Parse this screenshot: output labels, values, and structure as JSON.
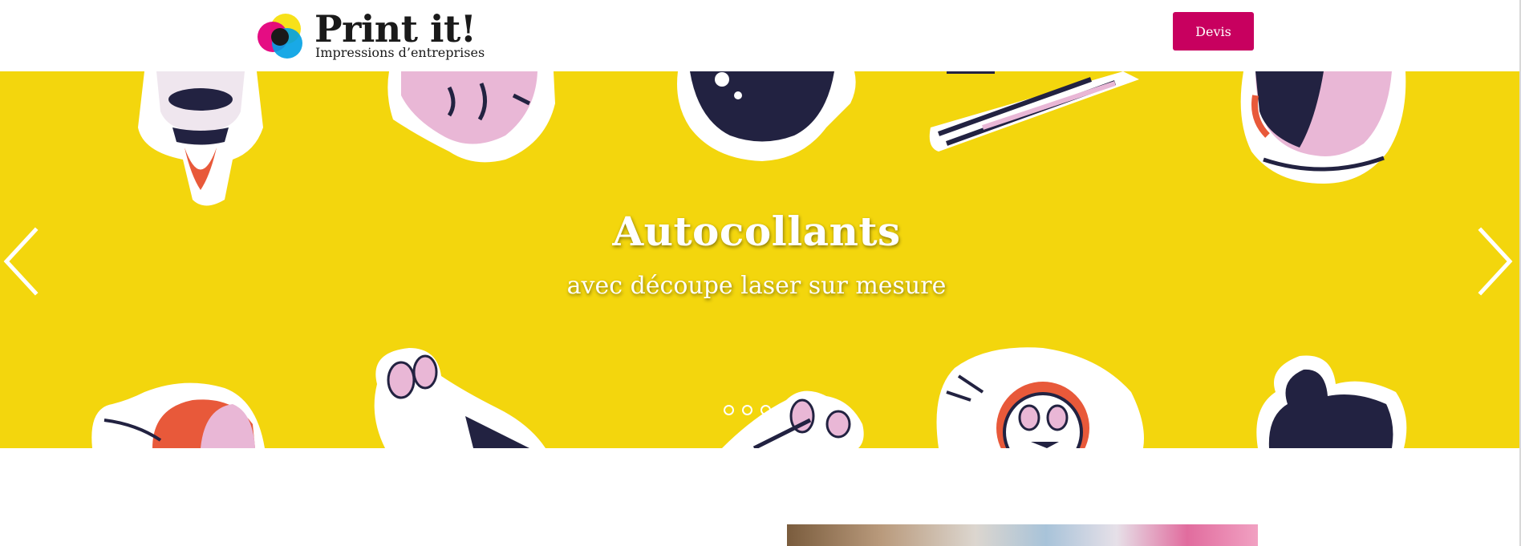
{
  "header": {
    "logo": {
      "title": "Print it!",
      "tagline": "Impressions d’entreprises",
      "icon": "cmyk-circles-logo-icon",
      "colors": [
        "#f7e11a",
        "#e4007c",
        "#00a0e3",
        "#1a1a1a"
      ]
    },
    "quote_button_label": "Devis"
  },
  "slider": {
    "title": "Autocollants",
    "subtitle": "avec découpe laser sur mesure",
    "background_color": "#f3d60d",
    "prev_icon": "chevron-left-icon",
    "next_icon": "chevron-right-icon",
    "active_dot": 4,
    "dot_count": 4
  },
  "colors": {
    "accent": "#c8005f",
    "navy": "#222241",
    "pink": "#e9b7d6",
    "orange": "#e8593a"
  }
}
